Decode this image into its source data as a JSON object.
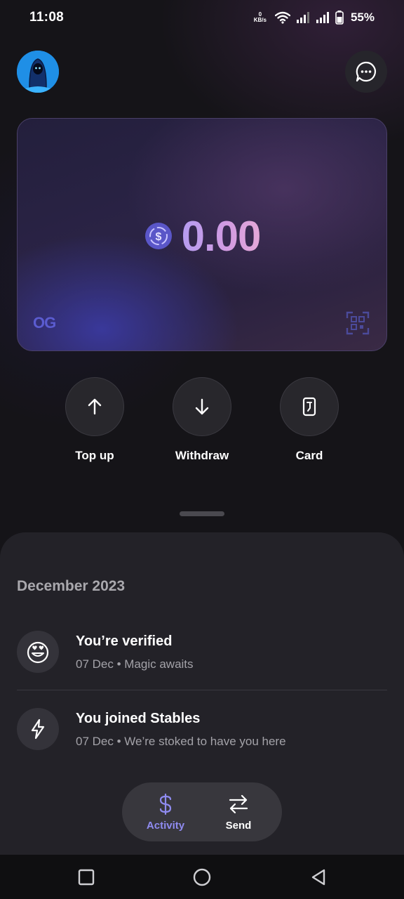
{
  "status_bar": {
    "time": "11:08",
    "net_speed_value": "0",
    "net_speed_unit": "KB/s",
    "battery": "55%"
  },
  "header": {
    "avatar_icon": "ghost-avatar-icon",
    "chat_icon": "chat-bubble-icon"
  },
  "card": {
    "balance": "0.00",
    "currency_icon": "usdc-coin-icon",
    "brand": "OG",
    "scan_icon": "qr-scan-icon"
  },
  "actions": [
    {
      "label": "Top up",
      "icon": "arrow-up-icon"
    },
    {
      "label": "Withdraw",
      "icon": "arrow-down-icon"
    },
    {
      "label": "Card",
      "icon": "card-icon"
    }
  ],
  "activity": {
    "month": "December 2023",
    "items": [
      {
        "title": "You’re verified",
        "subtitle": "07 Dec • Magic awaits",
        "icon": "heart-eyes-icon"
      },
      {
        "title": "You joined Stables",
        "subtitle": "07 Dec • We’re stoked to have you here",
        "icon": "lightning-icon"
      }
    ]
  },
  "bottom_nav": {
    "activity_label": "Activity",
    "send_label": "Send",
    "active": "Activity"
  },
  "colors": {
    "accent": "#8f8bf0",
    "background": "#151418",
    "sheet": "#232228"
  }
}
